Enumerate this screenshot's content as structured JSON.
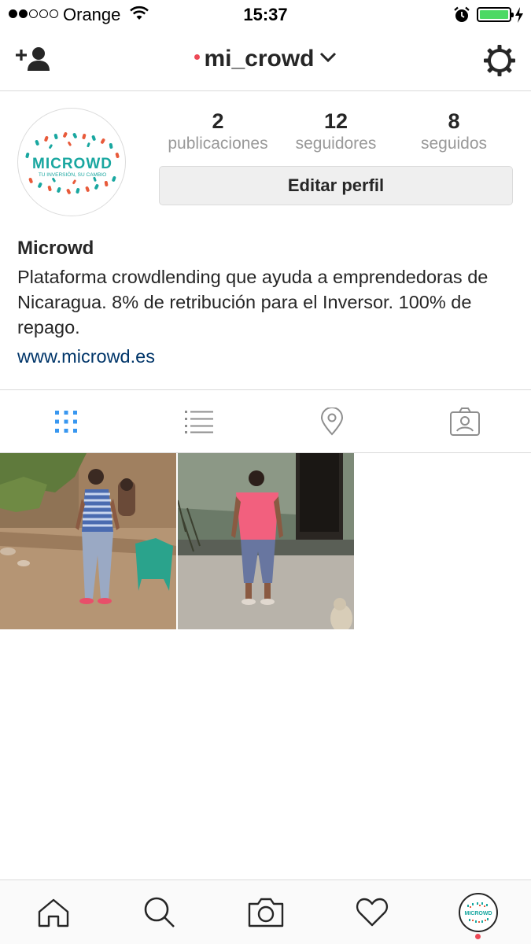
{
  "status_bar": {
    "carrier": "Orange",
    "time": "15:37",
    "signal_bars_filled": 2,
    "signal_bars_total": 5,
    "battery_level": 1.0
  },
  "nav": {
    "username": "mi_crowd",
    "icons": {
      "left": "add-user-icon",
      "right": "settings-gear-icon"
    }
  },
  "profile": {
    "avatar_logo_text": "MICROWD",
    "avatar_tagline": "TU INVERSIÓN, SU CAMBIO",
    "stats": [
      {
        "value": "2",
        "label": "publicaciones"
      },
      {
        "value": "12",
        "label": "seguidores"
      },
      {
        "value": "8",
        "label": "seguidos"
      }
    ],
    "edit_button_label": "Editar perfil"
  },
  "bio": {
    "name": "Microwd",
    "text": "Plataforma crowdlending que ayuda a emprendedoras de Nicaragua. 8% de retribución para el Inversor. 100% de repago.",
    "link": "www.microwd.es"
  },
  "tabs": [
    {
      "name": "grid-view",
      "icon": "grid-icon",
      "active": true
    },
    {
      "name": "list-view",
      "icon": "list-icon",
      "active": false
    },
    {
      "name": "map-view",
      "icon": "location-pin-icon",
      "active": false
    },
    {
      "name": "tagged",
      "icon": "tagged-photos-icon",
      "active": false
    }
  ],
  "posts": [
    {
      "subject": "woman in striped shirt standing in dirt yard"
    },
    {
      "subject": "woman in pink shirt standing near building"
    }
  ],
  "bottom_nav": [
    {
      "name": "home",
      "icon": "home-icon"
    },
    {
      "name": "search",
      "icon": "search-icon"
    },
    {
      "name": "camera",
      "icon": "camera-icon"
    },
    {
      "name": "activity",
      "icon": "heart-icon"
    },
    {
      "name": "profile",
      "icon": "profile-avatar-icon"
    }
  ],
  "colors": {
    "accent_blue": "#3897f0",
    "link_blue": "#003569",
    "notification_red": "#ed4956",
    "battery_green": "#4cd964"
  }
}
